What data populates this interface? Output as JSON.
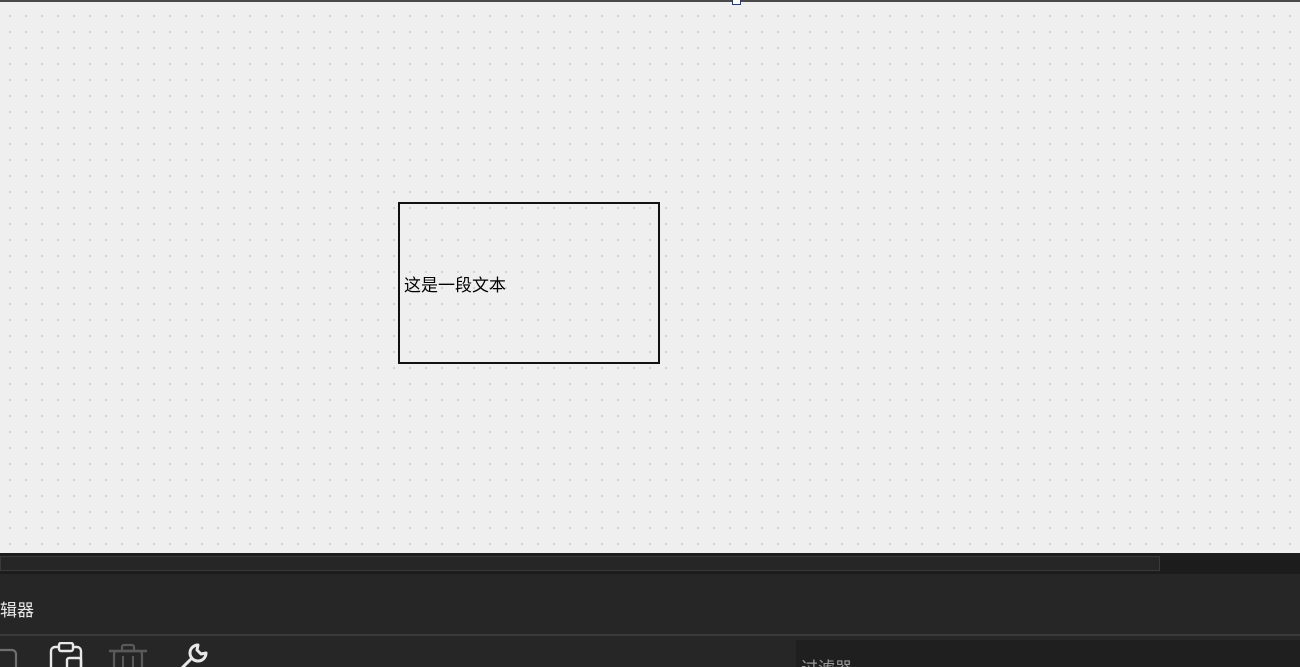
{
  "canvas": {
    "text_box_label": "这是一段文本",
    "background_color": "#efefef",
    "grid_dot_color": "#cfcfcf",
    "selection_handle_color": "#1e3a8a"
  },
  "editor_panel": {
    "title": "辑器",
    "toolbar": {
      "icons": [
        "square-icon",
        "paste-icon",
        "delete-icon",
        "wrench-icon"
      ]
    },
    "filter_label": "过滤器"
  },
  "theme": {
    "panel_background": "#262626",
    "text_color": "#e8e8e8",
    "muted_text_color": "#9a9a9a"
  }
}
